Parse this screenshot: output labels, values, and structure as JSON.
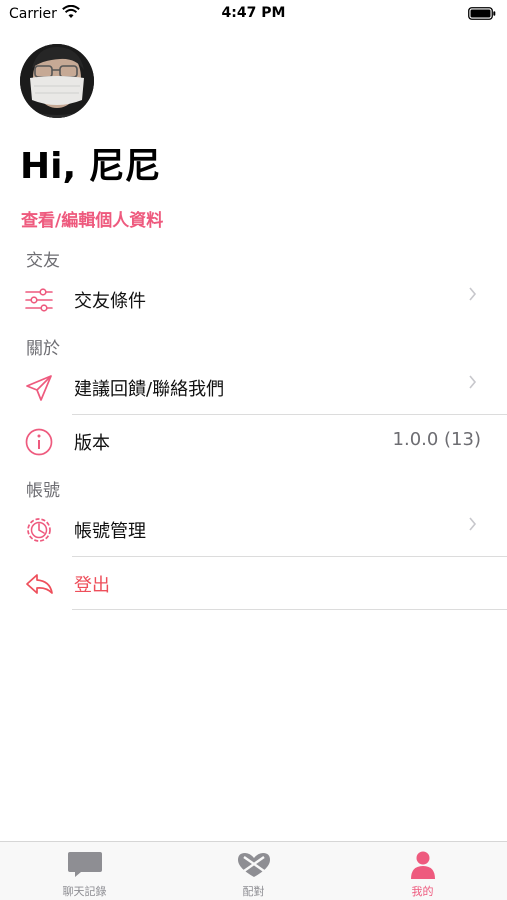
{
  "status_bar": {
    "carrier": "Carrier",
    "time": "4:47 PM",
    "wifi_icon": "wifi-icon",
    "battery_icon": "battery-full-icon"
  },
  "profile": {
    "greeting": "Hi, 尼尼",
    "edit_link": "查看/編輯個人資料",
    "avatar": "avatar-photo"
  },
  "sections": {
    "dating": {
      "header": "交友",
      "items": [
        {
          "label": "交友條件",
          "icon": "sliders-icon"
        }
      ]
    },
    "about": {
      "header": "關於",
      "items": [
        {
          "label": "建議回饋/聯絡我們",
          "icon": "paper-plane-icon"
        },
        {
          "label": "版本",
          "icon": "info-icon",
          "detail": "1.0.0 (13)"
        }
      ]
    },
    "account": {
      "header": "帳號",
      "items": [
        {
          "label": "帳號管理",
          "icon": "account-settings-icon"
        },
        {
          "label": "登出",
          "icon": "logout-arrow-icon"
        }
      ]
    }
  },
  "tab_bar": {
    "tabs": [
      {
        "label": "聊天記錄",
        "icon": "chat-bubble-icon"
      },
      {
        "label": "配對",
        "icon": "match-heart-icon"
      },
      {
        "label": "我的",
        "icon": "person-icon",
        "active": true
      }
    ]
  },
  "colors": {
    "accent": "#ee5a7e",
    "logout": "#ee4f5b",
    "section_header": "#6d6d72",
    "tab_inactive": "#8e8e93"
  }
}
